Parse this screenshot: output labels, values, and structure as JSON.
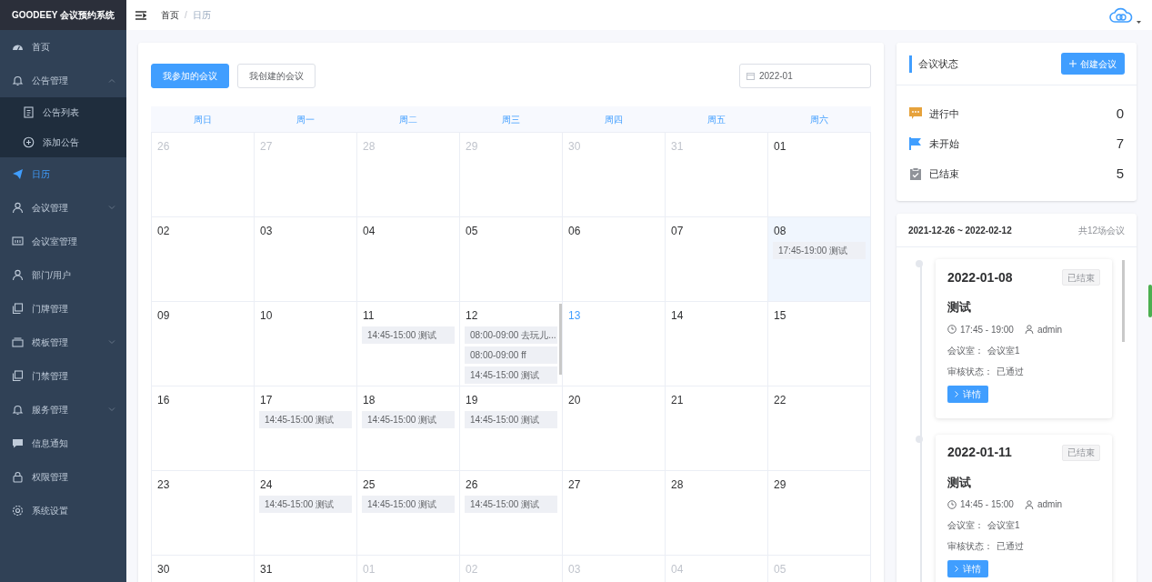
{
  "app": {
    "title": "GOODEEY 会议预约系统"
  },
  "sidebar": {
    "items": [
      {
        "label": "首页",
        "selected": false
      },
      {
        "label": "公告管理",
        "selected": false,
        "expanded": true,
        "children": [
          {
            "label": "公告列表",
            "selected": false
          },
          {
            "label": "添加公告",
            "selected": false
          }
        ]
      },
      {
        "label": "日历",
        "selected": true
      },
      {
        "label": "会议管理",
        "selected": false,
        "expanded": false
      },
      {
        "label": "会议室管理",
        "selected": false
      },
      {
        "label": "部门/用户",
        "selected": false
      },
      {
        "label": "门牌管理",
        "selected": false
      },
      {
        "label": "模板管理",
        "selected": false,
        "expanded": false
      },
      {
        "label": "门禁管理",
        "selected": false
      },
      {
        "label": "服务管理",
        "selected": false,
        "expanded": false
      },
      {
        "label": "信息通知",
        "selected": false
      },
      {
        "label": "权限管理",
        "selected": false
      },
      {
        "label": "系统设置",
        "selected": false
      }
    ]
  },
  "breadcrumb": {
    "items": [
      "首页",
      "日历"
    ],
    "separator": "/"
  },
  "calendar": {
    "tabs": [
      {
        "label": "我参加的会议",
        "selected": true
      },
      {
        "label": "我创建的会议",
        "selected": false
      }
    ],
    "month_picker": {
      "value": "2022-01"
    },
    "weekdays": [
      "周日",
      "周一",
      "周二",
      "周三",
      "周四",
      "周五",
      "周六"
    ],
    "days": [
      {
        "day": "26",
        "in_month": false,
        "today": false,
        "selected": false
      },
      {
        "day": "27",
        "in_month": false,
        "today": false,
        "selected": false
      },
      {
        "day": "28",
        "in_month": false,
        "today": false,
        "selected": false
      },
      {
        "day": "29",
        "in_month": false,
        "today": false,
        "selected": false
      },
      {
        "day": "30",
        "in_month": false,
        "today": false,
        "selected": false
      },
      {
        "day": "31",
        "in_month": false,
        "today": false,
        "selected": false
      },
      {
        "day": "01",
        "in_month": true,
        "today": false,
        "selected": false
      },
      {
        "day": "02",
        "in_month": true,
        "today": false,
        "selected": false
      },
      {
        "day": "03",
        "in_month": true,
        "today": false,
        "selected": false
      },
      {
        "day": "04",
        "in_month": true,
        "today": false,
        "selected": false
      },
      {
        "day": "05",
        "in_month": true,
        "today": false,
        "selected": false
      },
      {
        "day": "06",
        "in_month": true,
        "today": false,
        "selected": false
      },
      {
        "day": "07",
        "in_month": true,
        "today": false,
        "selected": false
      },
      {
        "day": "08",
        "in_month": true,
        "today": false,
        "selected": true,
        "events": [
          "17:45-19:00 测试"
        ]
      },
      {
        "day": "09",
        "in_month": true,
        "today": false,
        "selected": false
      },
      {
        "day": "10",
        "in_month": true,
        "today": false,
        "selected": false
      },
      {
        "day": "11",
        "in_month": true,
        "today": false,
        "selected": false,
        "events": [
          "14:45-15:00 测试"
        ]
      },
      {
        "day": "12",
        "in_month": true,
        "today": false,
        "selected": false,
        "events": [
          "08:00-09:00 去玩儿...",
          "08:00-09:00 ff",
          "14:45-15:00 测试"
        ]
      },
      {
        "day": "13",
        "in_month": true,
        "today": true,
        "selected": false
      },
      {
        "day": "14",
        "in_month": true,
        "today": false,
        "selected": false
      },
      {
        "day": "15",
        "in_month": true,
        "today": false,
        "selected": false
      },
      {
        "day": "16",
        "in_month": true,
        "today": false,
        "selected": false
      },
      {
        "day": "17",
        "in_month": true,
        "today": false,
        "selected": false,
        "events": [
          "14:45-15:00 测试"
        ]
      },
      {
        "day": "18",
        "in_month": true,
        "today": false,
        "selected": false,
        "events": [
          "14:45-15:00 测试"
        ]
      },
      {
        "day": "19",
        "in_month": true,
        "today": false,
        "selected": false,
        "events": [
          "14:45-15:00 测试"
        ]
      },
      {
        "day": "20",
        "in_month": true,
        "today": false,
        "selected": false
      },
      {
        "day": "21",
        "in_month": true,
        "today": false,
        "selected": false
      },
      {
        "day": "22",
        "in_month": true,
        "today": false,
        "selected": false
      },
      {
        "day": "23",
        "in_month": true,
        "today": false,
        "selected": false
      },
      {
        "day": "24",
        "in_month": true,
        "today": false,
        "selected": false,
        "events": [
          "14:45-15:00 测试"
        ]
      },
      {
        "day": "25",
        "in_month": true,
        "today": false,
        "selected": false,
        "events": [
          "14:45-15:00 测试"
        ]
      },
      {
        "day": "26",
        "in_month": true,
        "today": false,
        "selected": false,
        "events": [
          "14:45-15:00 测试"
        ]
      },
      {
        "day": "27",
        "in_month": true,
        "today": false,
        "selected": false
      },
      {
        "day": "28",
        "in_month": true,
        "today": false,
        "selected": false
      },
      {
        "day": "29",
        "in_month": true,
        "today": false,
        "selected": false
      },
      {
        "day": "30",
        "in_month": true,
        "today": false,
        "selected": false
      },
      {
        "day": "31",
        "in_month": true,
        "today": false,
        "selected": false
      },
      {
        "day": "01",
        "in_month": false,
        "today": false,
        "selected": false
      },
      {
        "day": "02",
        "in_month": false,
        "today": false,
        "selected": false
      },
      {
        "day": "03",
        "in_month": false,
        "today": false,
        "selected": false
      },
      {
        "day": "04",
        "in_month": false,
        "today": false,
        "selected": false
      },
      {
        "day": "05",
        "in_month": false,
        "today": false,
        "selected": false
      }
    ]
  },
  "status_panel": {
    "title": "会议状态",
    "create_button": "创建会议",
    "rows": [
      {
        "kind": "ongoing",
        "label": "进行中",
        "count": "0"
      },
      {
        "kind": "upcoming",
        "label": "未开始",
        "count": "7"
      },
      {
        "kind": "finished",
        "label": "已结束",
        "count": "5"
      }
    ]
  },
  "meetings_panel": {
    "range": "2021-12-26 ~ 2022-02-12",
    "total": "共12场会议",
    "meetings": [
      {
        "date": "2022-01-08",
        "status": "已结束",
        "title": "测试",
        "time": "17:45 - 19:00",
        "user": "admin",
        "room_label": "会议室：",
        "room": "会议室1",
        "review_label": "审核状态：",
        "review": "已通过",
        "button": "详情"
      },
      {
        "date": "2022-01-11",
        "status": "已结束",
        "title": "测试",
        "time": "14:45 - 15:00",
        "user": "admin",
        "room_label": "会议室：",
        "room": "会议室1",
        "review_label": "审核状态：",
        "review": "已通过",
        "button": "详情"
      }
    ]
  }
}
